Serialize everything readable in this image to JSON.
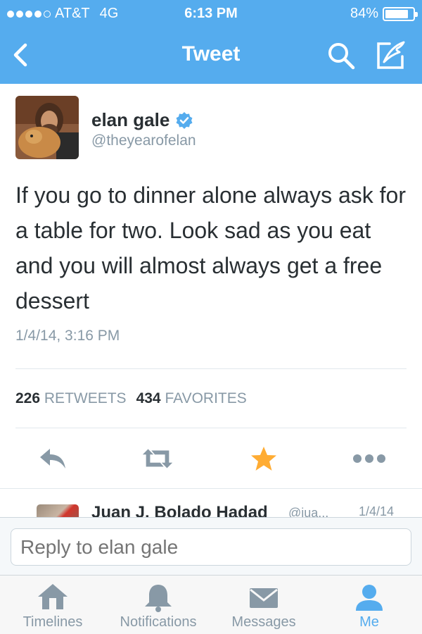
{
  "status_bar": {
    "carrier": "AT&T",
    "network": "4G",
    "time": "6:13 PM",
    "battery_percent": "84%",
    "battery_level": 0.84
  },
  "nav": {
    "title": "Tweet",
    "back_icon": "chevron-left-icon",
    "search_icon": "search-icon",
    "compose_icon": "compose-icon"
  },
  "tweet": {
    "author_name": "elan gale",
    "author_handle": "@theyearofelan",
    "verified": true,
    "text": "If you go to dinner alone always ask for a table for two. Look sad as you eat and you will almost always get a free dessert",
    "timestamp": "1/4/14, 3:16 PM",
    "retweets_count": "226",
    "retweets_label": "RETWEETS",
    "favorites_count": "434",
    "favorites_label": "FAVORITES",
    "favorited": true
  },
  "actions": [
    {
      "name": "reply",
      "icon": "reply-icon"
    },
    {
      "name": "retweet",
      "icon": "retweet-icon"
    },
    {
      "name": "favorite",
      "icon": "star-icon"
    },
    {
      "name": "more",
      "icon": "more-icon"
    }
  ],
  "reply_preview": {
    "name": "Juan J. Bolado Hadad",
    "handle": "@jua...",
    "date": "1/4/14"
  },
  "reply_box": {
    "placeholder": "Reply to elan gale"
  },
  "tabs": [
    {
      "label": "Timelines",
      "icon": "home-icon",
      "active": false
    },
    {
      "label": "Notifications",
      "icon": "bell-icon",
      "active": false
    },
    {
      "label": "Messages",
      "icon": "envelope-icon",
      "active": false
    },
    {
      "label": "Me",
      "icon": "person-icon",
      "active": true
    }
  ],
  "colors": {
    "brand_blue": "#55acee",
    "verified_blue": "#55acee",
    "star_gold": "#ffac33",
    "text_dark": "#292f33",
    "text_gray": "#8899a6"
  }
}
